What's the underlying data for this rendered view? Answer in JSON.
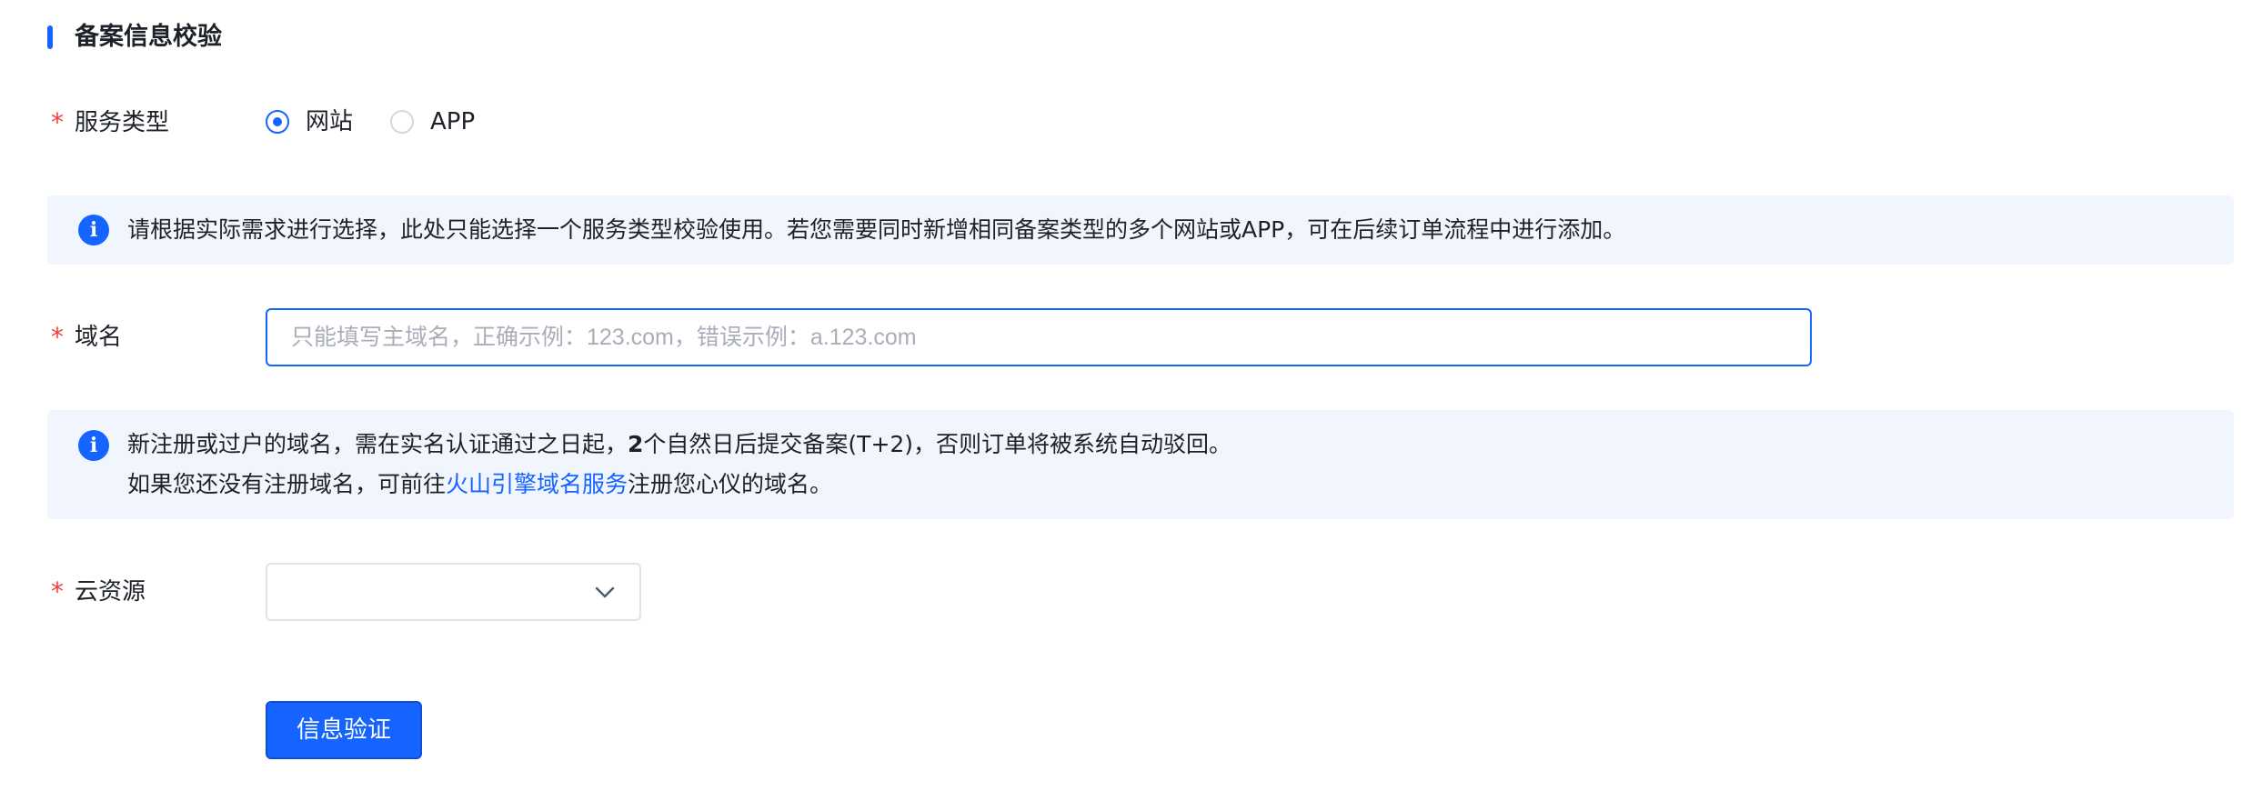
{
  "section": {
    "title": "备案信息校验"
  },
  "service_type": {
    "required_mark": "*",
    "label": "服务类型",
    "options": [
      {
        "label": "网站",
        "checked": true
      },
      {
        "label": "APP",
        "checked": false
      }
    ]
  },
  "service_alert": {
    "icon": "info-icon",
    "text": "请根据实际需求进行选择，此处只能选择一个服务类型校验使用。若您需要同时新增相同备案类型的多个网站或APP，可在后续订单流程中进行添加。"
  },
  "domain": {
    "required_mark": "*",
    "label": "域名",
    "value": "",
    "placeholder": "只能填写主域名，正确示例：123.com，错误示例：a.123.com"
  },
  "domain_alert": {
    "icon": "info-icon",
    "line1_before": "新注册或过户的域名，需在实名认证通过之日起，",
    "line1_bold": "2",
    "line1_after": "个自然日后提交备案(T+2)，否则订单将被系统自动驳回。",
    "line2_before": "如果您还没有注册域名，可前往",
    "line2_link": "火山引擎域名服务",
    "line2_after": "注册您心仪的域名。"
  },
  "cloud_resource": {
    "required_mark": "*",
    "label": "云资源",
    "selected_value": "",
    "icon": "chevron-down-icon"
  },
  "actions": {
    "verify_label": "信息验证"
  },
  "colors": {
    "primary": "#1664ff",
    "required": "#f53f3f",
    "alert_bg": "#f1f5fe"
  }
}
